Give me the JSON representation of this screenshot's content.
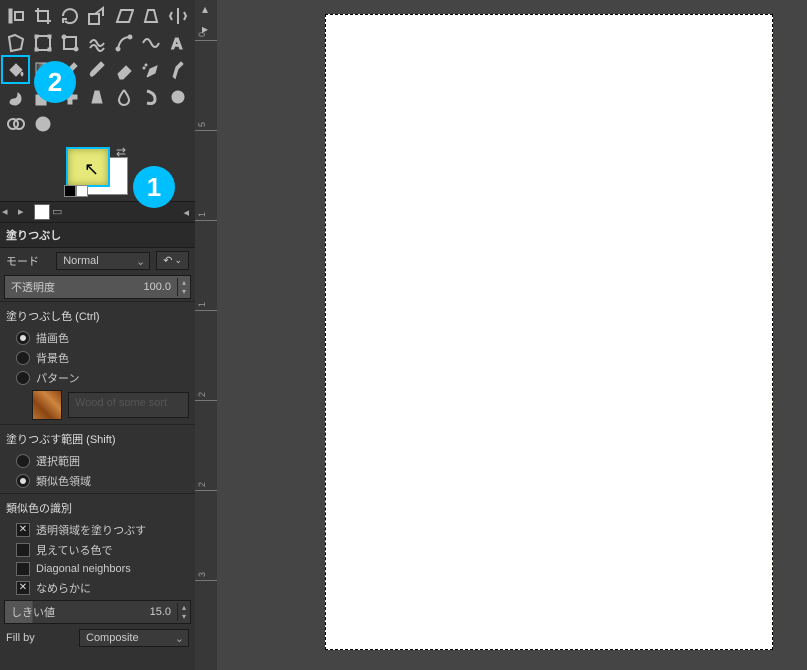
{
  "tool_title": "塗りつぶし",
  "mode": {
    "label": "モード",
    "value": "Normal"
  },
  "opacity": {
    "label": "不透明度",
    "value": "100.0"
  },
  "fill_color": {
    "group": "塗りつぶし色 (Ctrl)",
    "fg": "描画色",
    "bg": "背景色",
    "pattern": "パターン",
    "pattern_name": "Wood of some sort"
  },
  "fill_area": {
    "group": "塗りつぶす範囲 (Shift)",
    "selection": "選択範囲",
    "similar": "類似色領域"
  },
  "similar_detect": {
    "group": "類似色の識別",
    "transparent": "透明領域を塗りつぶす",
    "visible": "見えている色で",
    "diag": "Diagonal neighbors",
    "smooth": "なめらかに"
  },
  "threshold": {
    "label": "しきい値",
    "value": "15.0"
  },
  "fillby": {
    "label": "Fill by",
    "value": "Composite"
  },
  "ruler_ticks": [
    "0",
    "5",
    "1",
    "1",
    "2",
    "2",
    "3"
  ],
  "colors": {
    "fg": "#e6e87a",
    "bg": "#ffffff"
  },
  "badges": {
    "one": "1",
    "two": "2"
  }
}
